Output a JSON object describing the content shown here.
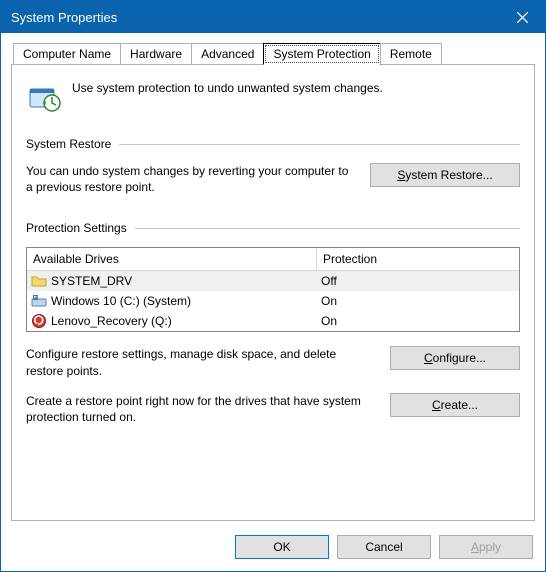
{
  "window": {
    "title": "System Properties"
  },
  "tabs": {
    "computer_name": "Computer Name",
    "hardware": "Hardware",
    "advanced": "Advanced",
    "system_protection": "System Protection",
    "remote": "Remote"
  },
  "intro": "Use system protection to undo unwanted system changes.",
  "restore": {
    "group": "System Restore",
    "text": "You can undo system changes by reverting your computer to a previous restore point.",
    "button_prefix": "S",
    "button_rest": "ystem Restore..."
  },
  "protection": {
    "group": "Protection Settings",
    "header_drives": "Available Drives",
    "header_protection": "Protection",
    "rows": [
      {
        "name": "SYSTEM_DRV",
        "status": "Off"
      },
      {
        "name": "Windows 10 (C:) (System)",
        "status": "On"
      },
      {
        "name": "Lenovo_Recovery (Q:)",
        "status": "On"
      }
    ],
    "configure_text": "Configure restore settings, manage disk space, and delete restore points.",
    "configure_prefix": "C",
    "configure_rest": "onfigure...",
    "create_text": "Create a restore point right now for the drives that have system protection turned on.",
    "create_prefix": "C",
    "create_rest": "reate..."
  },
  "footer": {
    "ok": "OK",
    "cancel": "Cancel",
    "apply_prefix": "A",
    "apply_rest": "pply"
  }
}
